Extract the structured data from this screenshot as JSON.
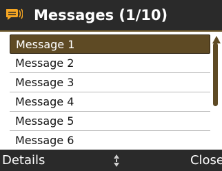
{
  "header": {
    "title": "Messages (1/10)",
    "icon": "message-speech-icon",
    "icon_color": "#f6a623"
  },
  "messages": {
    "items": [
      {
        "label": "Message 1",
        "selected": true
      },
      {
        "label": "Message 2",
        "selected": false
      },
      {
        "label": "Message 3",
        "selected": false
      },
      {
        "label": "Message 4",
        "selected": false
      },
      {
        "label": "Message 5",
        "selected": false
      },
      {
        "label": "Message 6",
        "selected": false
      }
    ]
  },
  "softkeys": {
    "left": "Details",
    "right": "Close",
    "center_icon": "up-down-nav-icon"
  },
  "colors": {
    "accent": "#5e4a24",
    "bar_bg": "#2a2a2a"
  }
}
